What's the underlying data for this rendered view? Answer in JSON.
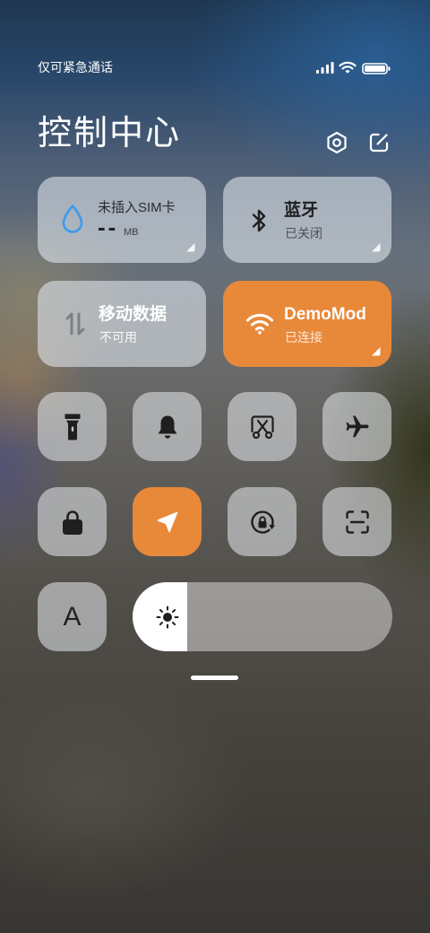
{
  "status_bar": {
    "carrier": "仅可紧急通话",
    "icons": [
      "signal-icon",
      "wifi-icon",
      "battery-icon"
    ]
  },
  "header": {
    "title": "控制中心",
    "icons": [
      "settings-icon",
      "edit-icon"
    ]
  },
  "cards": {
    "sim": {
      "icon": "water-drop-icon",
      "title": "未插入SIM卡",
      "usage": "--",
      "unit": "MB"
    },
    "bluetooth": {
      "icon": "bluetooth-icon",
      "title": "蓝牙",
      "status": "已关闭",
      "active": false
    },
    "mobile_data": {
      "icon": "data-arrows-icon",
      "title": "移动数据",
      "status": "不可用",
      "active": false
    },
    "wifi": {
      "icon": "wifi-icon",
      "title": "DemoMod",
      "status": "已连接",
      "active": true
    }
  },
  "toggles": [
    {
      "icon": "flashlight-icon",
      "active": false
    },
    {
      "icon": "bell-icon",
      "active": false
    },
    {
      "icon": "screenshot-icon",
      "active": false
    },
    {
      "icon": "airplane-icon",
      "active": false
    },
    {
      "icon": "lock-icon",
      "active": false
    },
    {
      "icon": "location-icon",
      "active": true
    },
    {
      "icon": "rotation-lock-icon",
      "active": false
    },
    {
      "icon": "scan-icon",
      "active": false
    }
  ],
  "font_size_button": {
    "label": "A"
  },
  "brightness": {
    "icon": "sun-icon",
    "level_percent": 21
  },
  "colors": {
    "accent": "#e8893a",
    "sim_icon": "#3a9bef",
    "icon_dark": "#1f1f1f"
  }
}
